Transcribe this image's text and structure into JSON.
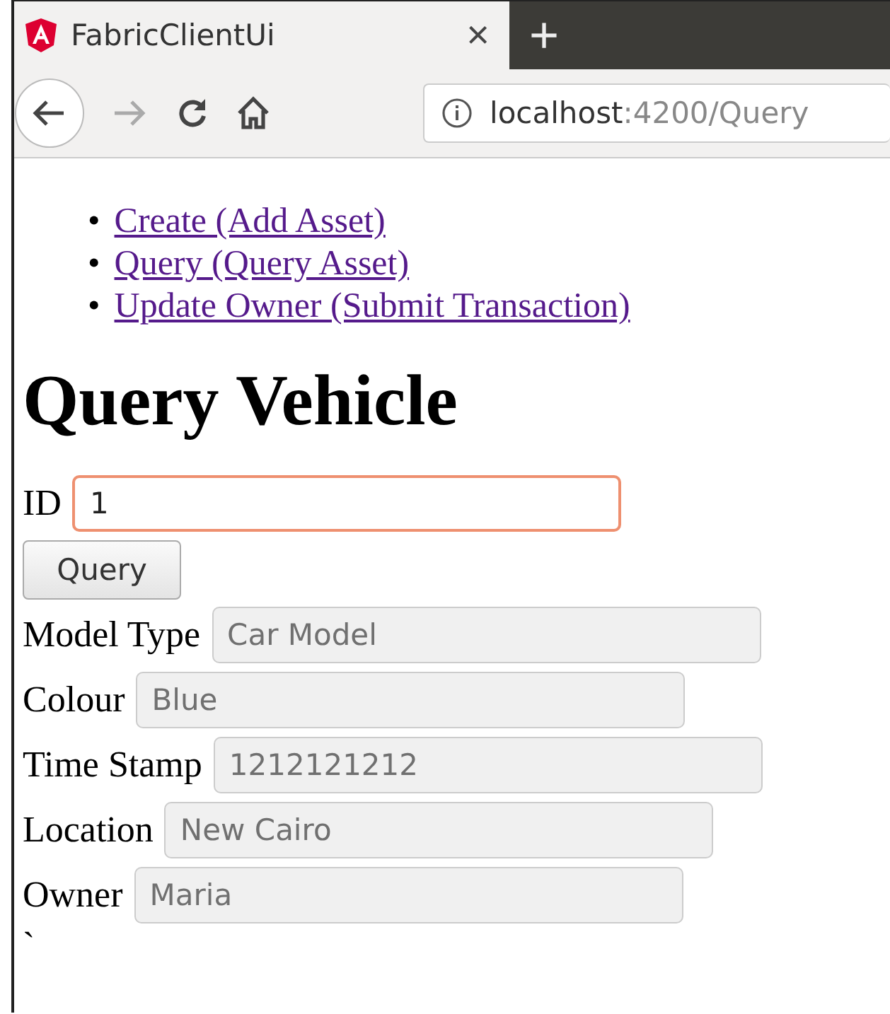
{
  "browser": {
    "tab_title": "FabricClientUi",
    "close": "×",
    "new_tab": "+",
    "url_host": "localhost",
    "url_path": ":4200/Query",
    "nav_buttons": [
      {
        "kind": "back",
        "disabled": false
      },
      {
        "kind": "forward",
        "disabled": true
      },
      {
        "kind": "reload",
        "disabled": false
      },
      {
        "kind": "home",
        "disabled": false
      }
    ]
  },
  "links": [
    {
      "marker": "•",
      "text": "Create (Add Asset)"
    },
    {
      "marker": "•",
      "text": "Query (Query Asset)"
    },
    {
      "marker": "•",
      "text": "Update Owner (Submit Transaction)"
    }
  ],
  "heading": "Query Vehicle",
  "id_field": {
    "label": "ID",
    "value": "1",
    "focused": true
  },
  "query_button": "Query",
  "fields": [
    {
      "label": "Model Type",
      "value": "Car Model",
      "disabled": true
    },
    {
      "label": "Colour",
      "value": "Blue",
      "disabled": true
    },
    {
      "label": "Time Stamp",
      "value": "1212121212",
      "disabled": true
    },
    {
      "label": "Location",
      "value": "New Cairo",
      "disabled": true
    },
    {
      "label": "Owner",
      "value": "Maria",
      "disabled": true
    }
  ],
  "trailing_text": "`"
}
